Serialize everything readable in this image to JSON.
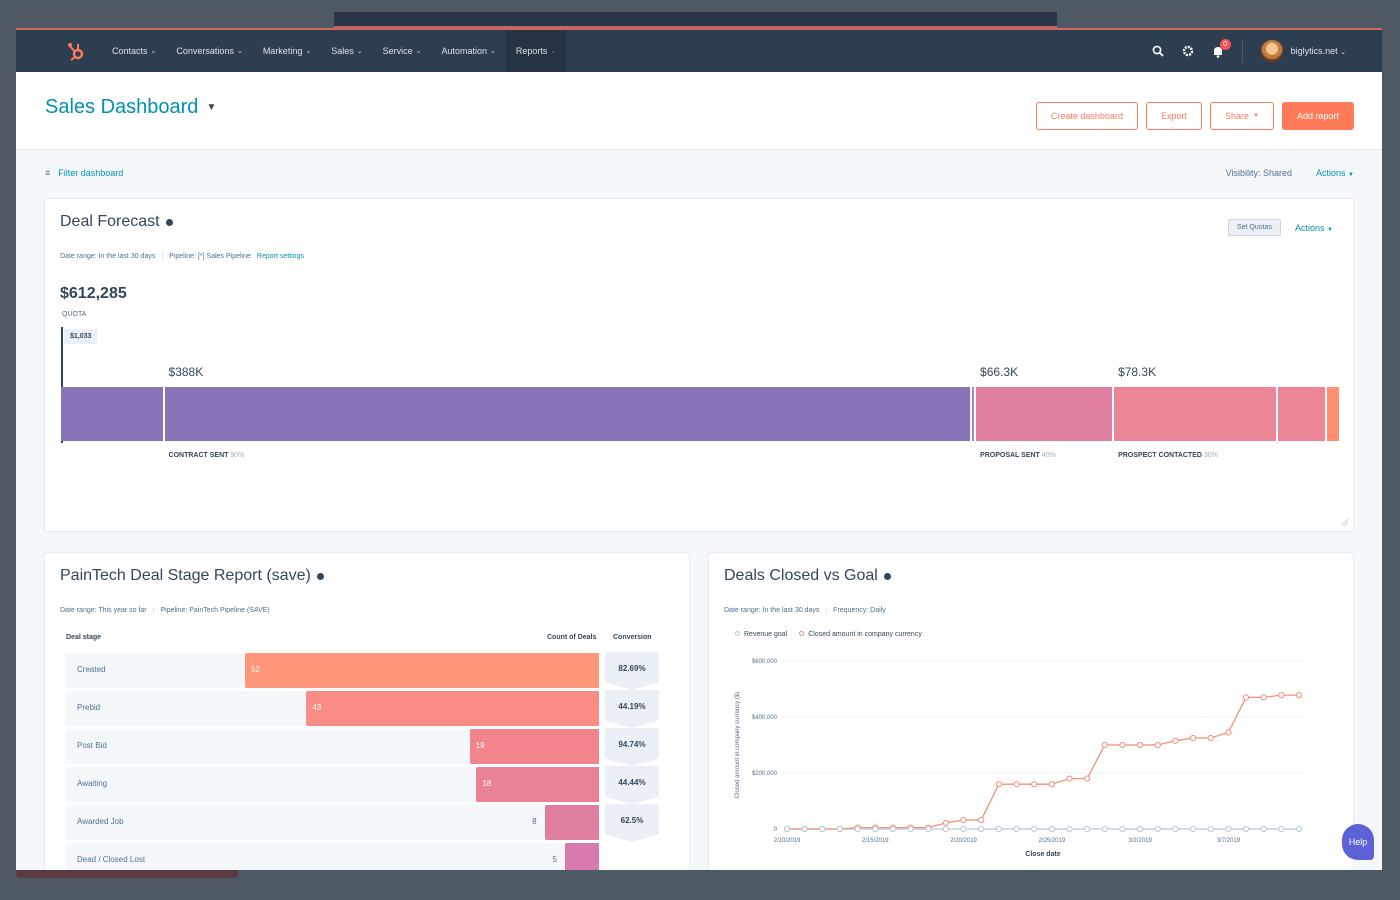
{
  "nav": {
    "items": [
      {
        "label": "Contacts"
      },
      {
        "label": "Conversations"
      },
      {
        "label": "Marketing"
      },
      {
        "label": "Sales"
      },
      {
        "label": "Service"
      },
      {
        "label": "Automation"
      },
      {
        "label": "Reports",
        "active": true
      }
    ],
    "notification_count": "0",
    "account": "biglytics.net",
    "icons": [
      "hubspot-logo",
      "search-icon",
      "gear-icon",
      "bell-icon",
      "avatar"
    ]
  },
  "header": {
    "title": "Sales Dashboard",
    "buttons": {
      "create_dashboard": "Create dashboard",
      "export": "Export",
      "share": "Share",
      "add_report": "Add report"
    }
  },
  "filter": {
    "label": "Filter dashboard",
    "visibility": "Visibility:  Shared",
    "actions": "Actions"
  },
  "deal_forecast": {
    "title": "Deal Forecast",
    "date_range": "Date range: In the last 30 days",
    "pipeline": "Pipeline: [*] Sales Pipeline",
    "report_settings": "Report settings",
    "set_quotas": "Set Quotas",
    "actions": "Actions",
    "total": "$612,285",
    "quota_label": "QUOTA",
    "quota_value": "$1,033",
    "accent_colors": {
      "purple": "#8a74b8",
      "pink": "#e07ea0",
      "rose": "#ec8596",
      "orange": "#ff8f6f"
    },
    "segments": [
      {
        "name": "closed-won",
        "share": 0.081,
        "color": "#8a74b8"
      },
      {
        "name": "contract-sent",
        "amount": "$388K",
        "stage": "CONTRACT SENT",
        "pct": "90%",
        "share": 0.632,
        "color": "#8a74b8"
      },
      {
        "name": "contract-sent-tail",
        "share": 0.003,
        "color": "#a08cc8"
      },
      {
        "name": "proposal-sent",
        "amount": "$66.3K",
        "stage": "PROPOSAL SENT",
        "pct": "40%",
        "share": 0.108,
        "color": "#e07ea0"
      },
      {
        "name": "prospect-contacted",
        "amount": "$78.3K",
        "stage": "PROSPECT CONTACTED",
        "pct": "30%",
        "share": 0.128,
        "color": "#ec8596"
      },
      {
        "name": "other-stage",
        "share": 0.039,
        "color": "#ec8596"
      },
      {
        "name": "lead-stage",
        "share": 0.009,
        "color": "#ff8f6f"
      }
    ]
  },
  "deal_stage": {
    "title": "PainTech Deal Stage Report (save)",
    "date_range": "Date range: This year so far",
    "pipeline": "Pipeline: PainTech Pipeline (SAVE)",
    "col_stage": "Deal stage",
    "col_count": "Count of Deals",
    "col_conversion": "Conversion",
    "rows": [
      {
        "stage": "Created",
        "count": 52,
        "conversion": "82.69%",
        "color": "#ff967a"
      },
      {
        "stage": "Prebid",
        "count": 43,
        "conversion": "44.19%",
        "color": "#f98d86"
      },
      {
        "stage": "Post Bid",
        "count": 19,
        "conversion": "94.74%",
        "color": "#f2858b"
      },
      {
        "stage": "Awaiting",
        "count": 18,
        "conversion": "44.44%",
        "color": "#ea8295"
      },
      {
        "stage": "Awarded Job",
        "count": 8,
        "conversion": "62.5%",
        "color": "#e07ea0"
      },
      {
        "stage": "Dead / Closed Lost",
        "count": 5,
        "conversion": "",
        "color": "#d77aac"
      }
    ]
  },
  "deals_closed": {
    "title": "Deals Closed vs Goal",
    "date_range": "Date range: In the last 30 days",
    "frequency": "Frequency: Daily",
    "help": "Help"
  },
  "chart_data": {
    "type": "line",
    "title": "Deals Closed vs Goal",
    "xlabel": "Close date",
    "ylabel": "Closed amount in company currency ($)",
    "ylim": [
      0,
      600000
    ],
    "yticks": [
      "0",
      "$200,000",
      "$400,000",
      "$600,000"
    ],
    "ytick_values": [
      0,
      200000,
      400000,
      600000
    ],
    "xtick_labels": [
      "2/10/2019",
      "2/15/2019",
      "2/20/2019",
      "2/25/2019",
      "3/2/2019",
      "3/7/2019"
    ],
    "xtick_index": [
      0,
      5,
      10,
      15,
      20,
      25
    ],
    "grid": true,
    "legend": "top-left",
    "series": [
      {
        "name": "Revenue goal",
        "color": "#b8c8d8",
        "values": [
          0,
          0,
          0,
          0,
          0,
          0,
          0,
          0,
          0,
          0,
          0,
          0,
          0,
          0,
          0,
          0,
          0,
          0,
          0,
          0,
          0,
          0,
          0,
          0,
          0,
          0,
          0,
          0,
          0,
          0
        ]
      },
      {
        "name": "Closed amount in company currency",
        "color": "#f0907a",
        "values": [
          0,
          0,
          0,
          0,
          5000,
          5000,
          5000,
          5000,
          5000,
          22000,
          32000,
          32000,
          160000,
          160000,
          160000,
          160000,
          180000,
          180000,
          300000,
          300000,
          300000,
          300000,
          315000,
          325000,
          325000,
          345000,
          470000,
          470000,
          478000,
          478000
        ]
      }
    ]
  }
}
